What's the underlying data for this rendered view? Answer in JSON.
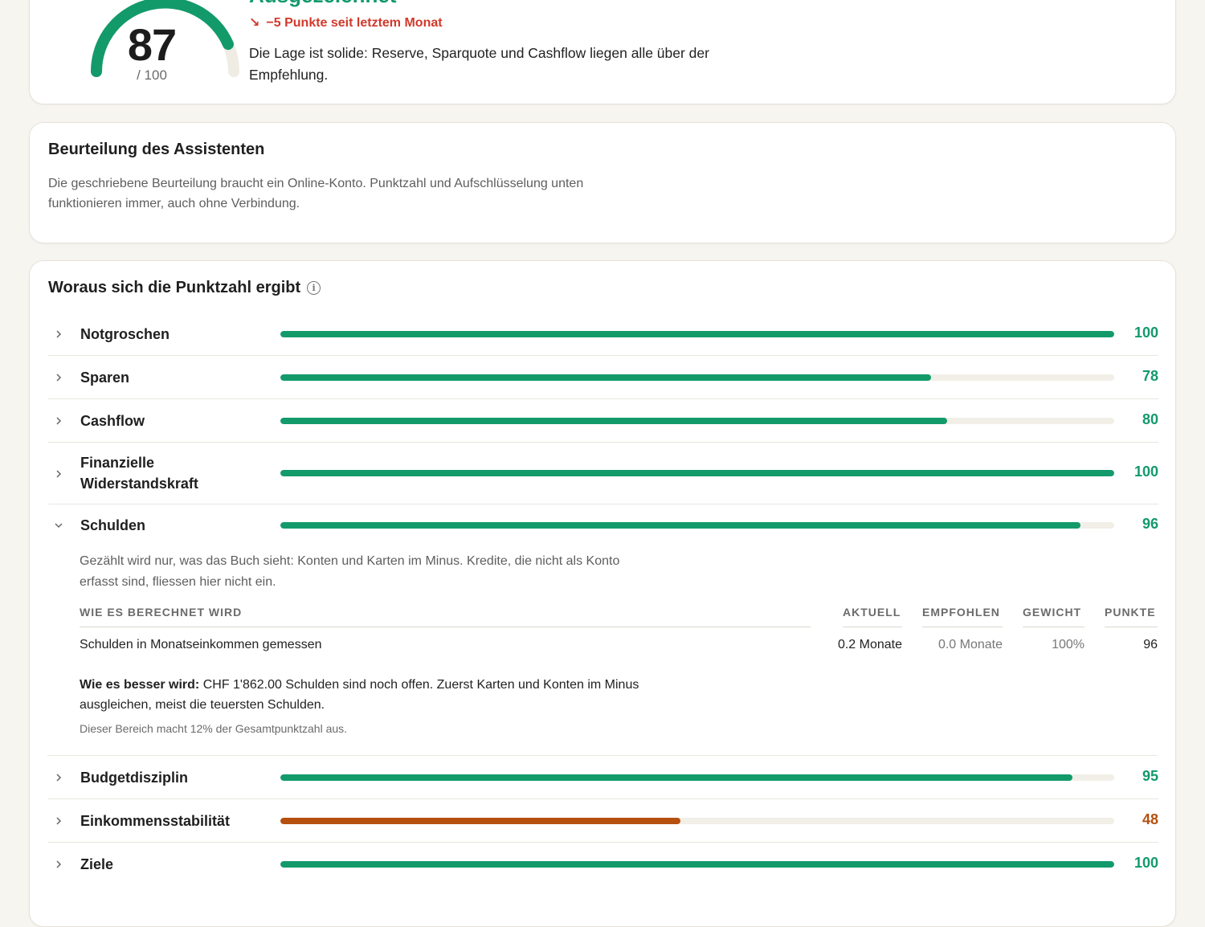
{
  "score": {
    "value": "87",
    "max_label": "/ 100",
    "score_fraction": 0.87,
    "rating": "Ausgezeichnet",
    "trend_text": "−5 Punkte seit letztem Monat",
    "summary": "Die Lage ist solide: Reserve, Sparquote und Cashflow liegen alle über der Empfehlung."
  },
  "assistant": {
    "title": "Beurteilung des Assistenten",
    "text": "Die geschriebene Beurteilung braucht ein Online-Konto. Punktzahl und Aufschlüsselung unten funktionieren immer, auch ohne Verbindung."
  },
  "breakdown": {
    "title": "Woraus sich die Punktzahl ergibt",
    "categories": [
      {
        "label": "Notgroschen",
        "value": "100",
        "pct": 100,
        "expanded": false
      },
      {
        "label": "Sparen",
        "value": "78",
        "pct": 78,
        "expanded": false
      },
      {
        "label": "Cashflow",
        "value": "80",
        "pct": 80,
        "expanded": false
      },
      {
        "label": "Finanzielle Widerstandskraft",
        "value": "100",
        "pct": 100,
        "expanded": false
      },
      {
        "label": "Schulden",
        "value": "96",
        "pct": 96,
        "expanded": true
      },
      {
        "label": "Budgetdisziplin",
        "value": "95",
        "pct": 95,
        "expanded": false
      },
      {
        "label": "Einkommensstabilität",
        "value": "48",
        "pct": 48,
        "expanded": false
      },
      {
        "label": "Ziele",
        "value": "100",
        "pct": 100,
        "expanded": false
      }
    ],
    "debt_detail": {
      "description": "Gezählt wird nur, was das Buch sieht: Konten und Karten im Minus. Kredite, die nicht als Konto erfasst sind, fliessen hier nicht ein.",
      "headers": {
        "method": "WIE ES BERECHNET WIRD",
        "current": "AKTUELL",
        "recommended": "EMPFOHLEN",
        "weight": "GEWICHT",
        "points": "PUNKTE"
      },
      "row": {
        "method": "Schulden in Monatseinkommen gemessen",
        "current": "0.2 Monate",
        "recommended": "0.0 Monate",
        "weight": "100%",
        "points": "96"
      },
      "advice_label": "Wie es besser wird:",
      "advice_text": "CHF 1'862.00 Schulden sind noch offen. Zuerst Karten und Konten im Minus ausgleichen, meist die teuersten Schulden.",
      "share": "Dieser Bereich macht 12% der Gesamtpunktzahl aus."
    }
  },
  "colors": {
    "good": "#139a6b",
    "warn": "#b5500f",
    "down": "#d2392b",
    "track": "#f1efe7"
  }
}
